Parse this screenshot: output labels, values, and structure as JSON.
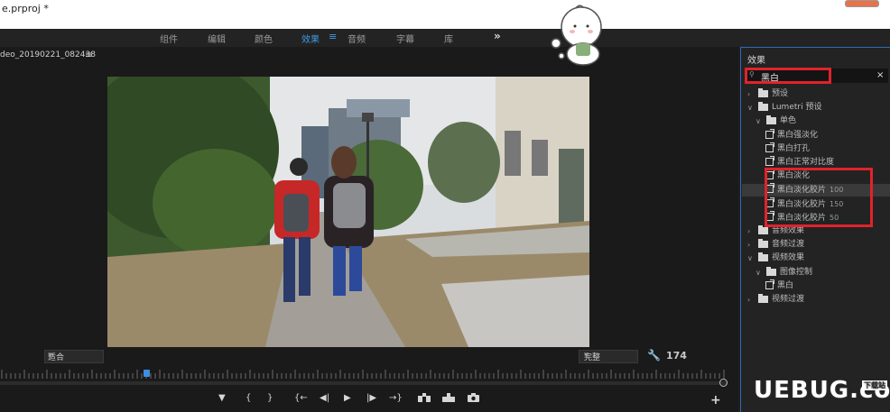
{
  "window": {
    "title": "e.prproj *"
  },
  "workspaces": {
    "items": [
      {
        "label": "组件",
        "active": false
      },
      {
        "label": "编辑",
        "active": false
      },
      {
        "label": "颜色",
        "active": false
      },
      {
        "label": "效果",
        "active": true
      },
      {
        "label": "音频",
        "active": false
      },
      {
        "label": "字幕",
        "active": false
      },
      {
        "label": "库",
        "active": false
      }
    ],
    "more": "»",
    "menu_icon": "≡"
  },
  "program_monitor": {
    "sequence_name": "deo_20190221_082438",
    "menu_icon": "≡",
    "fit_select": "适合",
    "quality_select": "完整",
    "wrench_icon": "🔧",
    "frame_value": "174",
    "controls": [
      "▼",
      "{",
      "}",
      "{←",
      "◀|",
      "▶",
      "|▶",
      "→}",
      "insert-icon",
      "overwrite-icon",
      "camera-icon"
    ],
    "add_button": "+"
  },
  "effects_panel": {
    "title": "效果",
    "search": {
      "value": "黑白",
      "clear": "×"
    },
    "tree": [
      {
        "type": "folder",
        "label": "预设",
        "expanded": false,
        "level": 0
      },
      {
        "type": "folder",
        "label": "Lumetri 预设",
        "expanded": true,
        "level": 0
      },
      {
        "type": "folder",
        "label": "单色",
        "expanded": true,
        "level": 1
      },
      {
        "type": "effect",
        "label": "黑白强淡化",
        "level": 2
      },
      {
        "type": "effect",
        "label": "黑白打孔",
        "level": 2
      },
      {
        "type": "effect",
        "label": "黑白正常对比度",
        "level": 2
      },
      {
        "type": "effect",
        "label": "黑白淡化",
        "level": 2
      },
      {
        "type": "effect",
        "label": "黑白淡化胶片",
        "num": "100",
        "level": 2,
        "selected": true
      },
      {
        "type": "effect",
        "label": "黑白淡化胶片",
        "num": "150",
        "level": 2
      },
      {
        "type": "effect",
        "label": "黑白淡化胶片",
        "num": "50",
        "level": 2
      },
      {
        "type": "folder",
        "label": "音频效果",
        "expanded": false,
        "level": 0
      },
      {
        "type": "folder",
        "label": "音频过渡",
        "expanded": false,
        "level": 0
      },
      {
        "type": "folder",
        "label": "视频效果",
        "expanded": true,
        "level": 0
      },
      {
        "type": "folder",
        "label": "图像控制",
        "expanded": true,
        "level": 1
      },
      {
        "type": "effect",
        "label": "黑白",
        "level": 2
      },
      {
        "type": "folder",
        "label": "视频过渡",
        "expanded": false,
        "level": 0
      }
    ]
  },
  "colors": {
    "accent": "#3d9be9",
    "highlight_red": "#e0232b",
    "panel_bg": "#232323"
  },
  "watermark": {
    "text": "UEBUG.com",
    "badge": "下载站"
  }
}
